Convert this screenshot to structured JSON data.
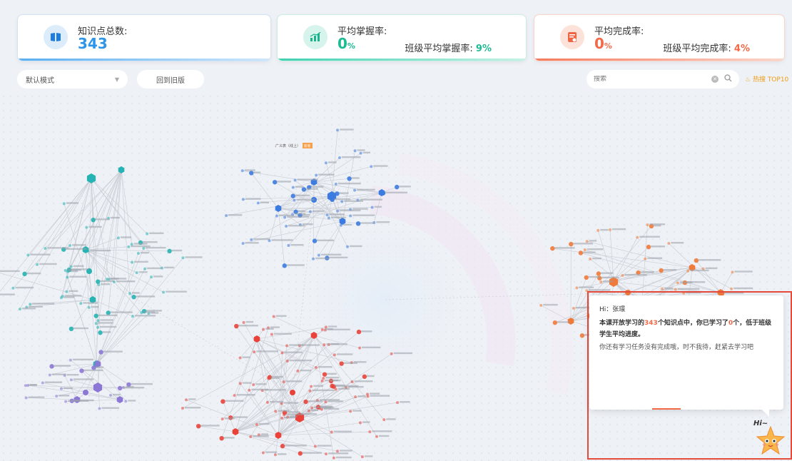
{
  "cards": {
    "total": {
      "label": "知识点总数:",
      "value": "343",
      "icon": "book-icon",
      "color": "#2d95ea"
    },
    "mastery": {
      "label": "平均掌握率:",
      "value": "0",
      "unit": "%",
      "sub_label": "班级平均掌握率:",
      "sub_value": "9%",
      "icon": "chart-icon",
      "color": "#1dbb93"
    },
    "completion": {
      "label": "平均完成率:",
      "value": "0",
      "unit": "%",
      "sub_label": "班级平均完成率:",
      "sub_value": "4%",
      "icon": "document-icon",
      "color": "#f26a48"
    }
  },
  "toolbar": {
    "mode_select": "默认模式",
    "old_version_button": "回到旧版",
    "search_placeholder": "搜索",
    "hot_label": "热搜 TOP10"
  },
  "graph": {
    "highlight_node": "广义表（线上）",
    "highlight_badge": "新增"
  },
  "popup": {
    "greeting": "Hi：张璟",
    "msg_prefix": "本课开放学习的",
    "msg_total": "343",
    "msg_mid": "个知识点中，你已学习了",
    "msg_learned": "0",
    "msg_suffix": "个，低于班级学生平均进度。",
    "msg2": "你还有学习任务没有完成哦，时不我待，赶紧去学习吧",
    "hi_tag": "Hi~"
  },
  "colors": {
    "cluster_teal": "#27b3b3",
    "cluster_blue": "#3c7be0",
    "cluster_red": "#e8423a",
    "cluster_purple": "#8b78d6",
    "cluster_orange": "#f07a3a"
  }
}
